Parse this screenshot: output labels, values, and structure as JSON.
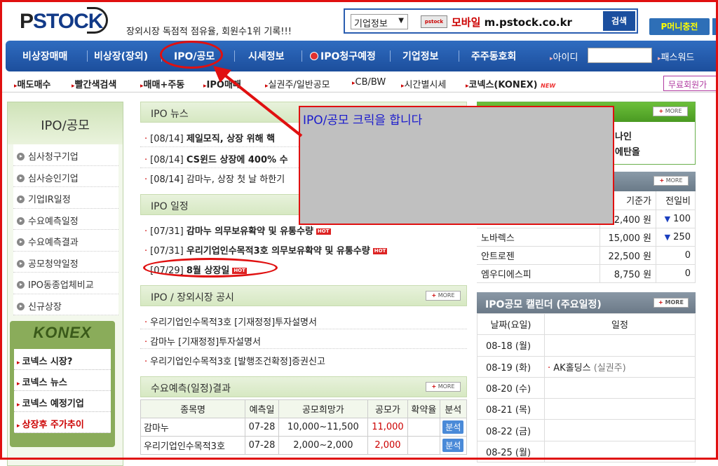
{
  "header": {
    "logo_p": "P",
    "logo_rest": "STOCK",
    "slogan": "장외시장 독점적 점유율, 회원수1위 기록!!!",
    "search_select": "기업정보",
    "mobile_icon": "pstock",
    "mobile_label": "모바일",
    "mobile_url": "m.pstock.co.kr",
    "search_button": "검색",
    "pmoney_button": "P머니충전"
  },
  "nav": {
    "items": [
      "비상장매매",
      "비상장(장외)",
      "IPO/공모",
      "시세정보",
      "IPO청구예정",
      "기업정보",
      "주주동호회"
    ],
    "id_label": "아이디",
    "pw_label": "패스워드"
  },
  "subnav": {
    "items": [
      "매도매수",
      "빨간색검색",
      "매매+주동",
      "IPO매매",
      "실권주/일반공모",
      "CB/BW",
      "시간별시세",
      "코넥스(KONEX)"
    ],
    "new_tag": "NEW",
    "free_button": "무료회원가"
  },
  "left": {
    "title": "IPO/공모",
    "items": [
      "심사청구기업",
      "심사승인기업",
      "기업IR일정",
      "수요예측일정",
      "수요예측결과",
      "공모청약일정",
      "IPO동종업체비교",
      "신규상장"
    ],
    "konex_title": "KONEX",
    "konex_items": [
      "코넥스 시장?",
      "코넥스 뉴스",
      "코넥스 예정기업",
      "상장후 주가추이"
    ]
  },
  "main": {
    "more_label": "MORE",
    "hot_label": "HOT",
    "ipo_news": {
      "title": "IPO 뉴스",
      "items": [
        {
          "date": "[08/14]",
          "text": "제일모직, 상장 위해 핵"
        },
        {
          "date": "[08/14]",
          "text": "CS윈드 상장에 400% 수"
        },
        {
          "date": "[08/14]",
          "text": "감마누, 상장 첫 날 하한기"
        }
      ]
    },
    "ipo_schedule": {
      "title": "IPO 일정",
      "items": [
        {
          "date": "[07/31]",
          "text": "감마누 의무보유확약 및 유통수량"
        },
        {
          "date": "[07/31]",
          "text": "우리기업인수목적3호 의무보유확약 및 유통수량"
        },
        {
          "date": "[07/29]",
          "text": "8월 상장일"
        }
      ]
    },
    "ipo_notice": {
      "title": "IPO / 장외시장 공시",
      "items": [
        "우리기업인수목적3호 [기재정정]투자설명서",
        "감마누 [기재정정]투자설명서",
        "우리기업인수목적3호 [발행조건확정]증권신고"
      ]
    },
    "demand": {
      "title": "수요예측(일정)결과",
      "headers": [
        "종목명",
        "예측일",
        "공모희망가",
        "공모가",
        "확약율",
        "분석"
      ],
      "rows": [
        {
          "name": "감마누",
          "date": "07-28",
          "range": "10,000~11,500",
          "price": "11,000",
          "ratio": "",
          "btn": "분석"
        },
        {
          "name": "우리기업인수목적3호",
          "date": "07-28",
          "range": "2,000~2,000",
          "price": "2,000",
          "ratio": "",
          "btn": "분석"
        }
      ]
    }
  },
  "right": {
    "box1_lines": [
      "나인",
      "에탄올"
    ],
    "price_headers": [
      "기준가",
      "전일비"
    ],
    "price_rows": [
      {
        "name": "",
        "price": "22,400 원",
        "change": "100",
        "down": true
      },
      {
        "name": "노바렉스",
        "price": "15,000 원",
        "change": "250",
        "down": true
      },
      {
        "name": "안트로젠",
        "price": "22,500 원",
        "change": "0",
        "down": false
      },
      {
        "name": "엠우디에스피",
        "price": "8,750 원",
        "change": "0",
        "down": false
      }
    ],
    "calendar": {
      "title": "IPO공모 캘린더 (주요일정)",
      "headers": [
        "날짜(요일)",
        "일정"
      ],
      "rows": [
        {
          "date": "08-18 (월)",
          "event": ""
        },
        {
          "date": "08-19 (화)",
          "event": "AK홀딩스",
          "event_sub": "(실권주)"
        },
        {
          "date": "08-20 (수)",
          "event": ""
        },
        {
          "date": "08-21 (목)",
          "event": ""
        },
        {
          "date": "08-22 (금)",
          "event": ""
        },
        {
          "date": "08-25 (월)",
          "event": ""
        }
      ]
    }
  },
  "annotation": {
    "popup_text": "IPO/공모 크릭을 합니다",
    "color": "#e01010"
  }
}
